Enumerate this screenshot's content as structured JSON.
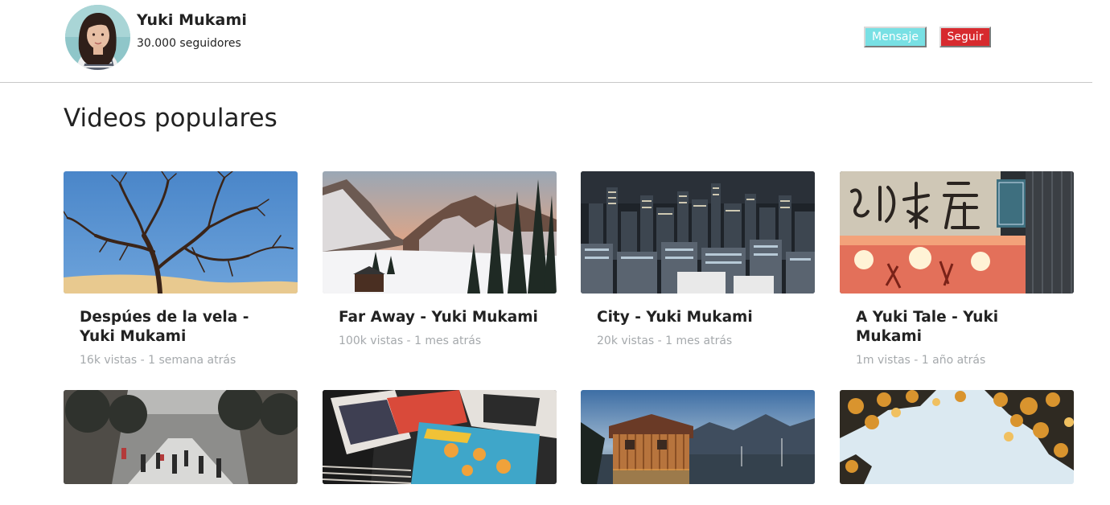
{
  "profile": {
    "name": "Yuki Mukami",
    "followers": "30.000 seguidores"
  },
  "actions": {
    "message_label": "Mensaje",
    "follow_label": "Seguir"
  },
  "section": {
    "title": "Videos populares"
  },
  "videos": [
    {
      "title": "Despúes de la vela - Yuki Mukami",
      "meta": "16k vistas - 1 semana atrás",
      "thumbnail": "bare-tree-blue-sky"
    },
    {
      "title": "Far Away - Yuki Mukami",
      "meta": "100k vistas - 1 mes atrás",
      "thumbnail": "snowy-mountain-valley"
    },
    {
      "title": "City - Yuki Mukami",
      "meta": "20k vistas - 1 mes atrás",
      "thumbnail": "city-skyline-night"
    },
    {
      "title": "A Yuki Tale - Yuki Mukami",
      "meta": "1m vistas - 1 año atrás",
      "thumbnail": "japanese-shop-sign"
    },
    {
      "thumbnail": "city-street-crowd"
    },
    {
      "thumbnail": "magazines-stack"
    },
    {
      "thumbnail": "lake-boathouse"
    },
    {
      "thumbnail": "autumn-leaves-sky"
    }
  ],
  "colors": {
    "message_button": "#78e0e4",
    "follow_button": "#d72a2e",
    "meta_text": "#a5a9ac"
  }
}
